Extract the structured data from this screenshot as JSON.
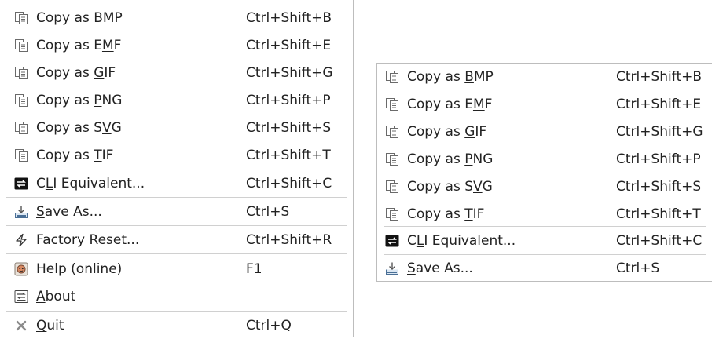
{
  "menu_left": {
    "items": [
      {
        "icon": "copy-icon",
        "pre": "Copy as ",
        "mn": "B",
        "post": "MP",
        "shortcut": "Ctrl+Shift+B"
      },
      {
        "icon": "copy-icon",
        "pre": "Copy as E",
        "mn": "M",
        "post": "F",
        "shortcut": "Ctrl+Shift+E"
      },
      {
        "icon": "copy-icon",
        "pre": "Copy as ",
        "mn": "G",
        "post": "IF",
        "shortcut": "Ctrl+Shift+G"
      },
      {
        "icon": "copy-icon",
        "pre": "Copy as ",
        "mn": "P",
        "post": "NG",
        "shortcut": "Ctrl+Shift+P"
      },
      {
        "icon": "copy-icon",
        "pre": "Copy as S",
        "mn": "V",
        "post": "G",
        "shortcut": "Ctrl+Shift+S"
      },
      {
        "icon": "copy-icon",
        "pre": "Copy as ",
        "mn": "T",
        "post": "IF",
        "shortcut": "Ctrl+Shift+T"
      },
      {
        "icon": "cli-icon",
        "pre": "C",
        "mn": "L",
        "post": "I Equivalent...",
        "shortcut": "Ctrl+Shift+C"
      },
      {
        "icon": "save-icon",
        "pre": "",
        "mn": "S",
        "post": "ave As...",
        "shortcut": "Ctrl+S"
      },
      {
        "icon": "lightning-icon",
        "pre": "Factory ",
        "mn": "R",
        "post": "eset...",
        "shortcut": "Ctrl+Shift+R"
      },
      {
        "icon": "help-icon",
        "pre": "",
        "mn": "H",
        "post": "elp (online)",
        "shortcut": "F1"
      },
      {
        "icon": "about-icon",
        "pre": "",
        "mn": "A",
        "post": "bout",
        "shortcut": ""
      },
      {
        "icon": "quit-icon",
        "pre": "",
        "mn": "Q",
        "post": "uit",
        "shortcut": "Ctrl+Q"
      }
    ]
  },
  "menu_right": {
    "items": [
      {
        "icon": "copy-icon",
        "pre": "Copy as ",
        "mn": "B",
        "post": "MP",
        "shortcut": "Ctrl+Shift+B"
      },
      {
        "icon": "copy-icon",
        "pre": "Copy as E",
        "mn": "M",
        "post": "F",
        "shortcut": "Ctrl+Shift+E"
      },
      {
        "icon": "copy-icon",
        "pre": "Copy as ",
        "mn": "G",
        "post": "IF",
        "shortcut": "Ctrl+Shift+G"
      },
      {
        "icon": "copy-icon",
        "pre": "Copy as ",
        "mn": "P",
        "post": "NG",
        "shortcut": "Ctrl+Shift+P"
      },
      {
        "icon": "copy-icon",
        "pre": "Copy as S",
        "mn": "V",
        "post": "G",
        "shortcut": "Ctrl+Shift+S"
      },
      {
        "icon": "copy-icon",
        "pre": "Copy as ",
        "mn": "T",
        "post": "IF",
        "shortcut": "Ctrl+Shift+T"
      },
      {
        "icon": "cli-icon",
        "pre": "C",
        "mn": "L",
        "post": "I Equivalent...",
        "shortcut": "Ctrl+Shift+C"
      },
      {
        "icon": "save-icon",
        "pre": "",
        "mn": "S",
        "post": "ave As...",
        "shortcut": "Ctrl+S"
      }
    ]
  }
}
